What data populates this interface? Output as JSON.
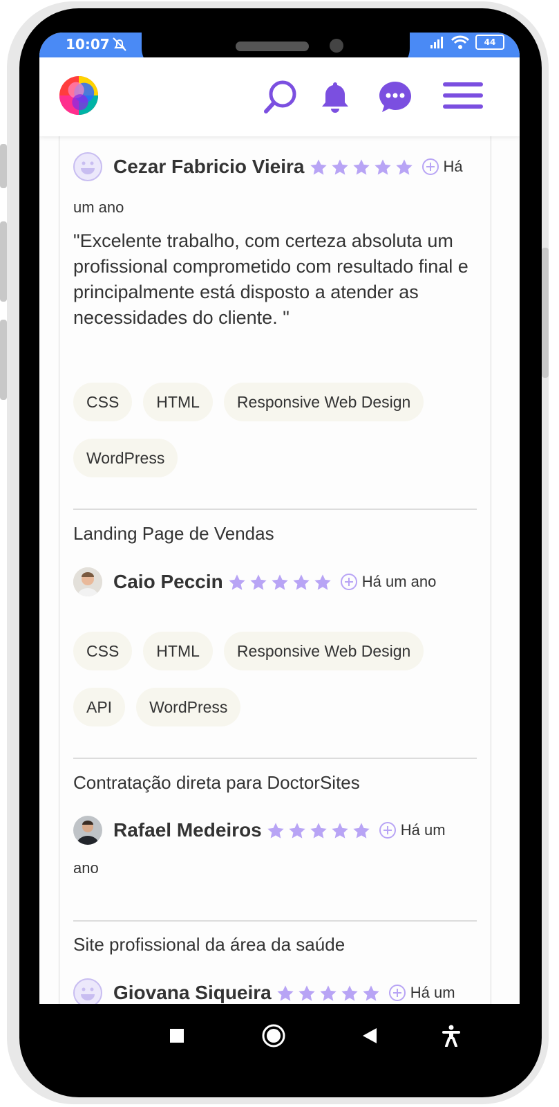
{
  "status_bar": {
    "time": "10:07",
    "battery": "44"
  },
  "header": {
    "logo_icon": "app-logo",
    "icons": [
      "search-icon",
      "bell-icon",
      "chat-icon",
      "menu-icon"
    ],
    "accent": "#7b4fe0"
  },
  "reviews": [
    {
      "project_title": "",
      "reviewer": "Cezar Fabricio Vieira",
      "rating": 5,
      "time_ago": "Há um ano",
      "time_ago_part1": "Há",
      "time_ago_part2": "um ano",
      "comment": "\"Excelente trabalho, com certeza absoluta um profissional comprometido com resultado final e principalmente está disposto a atender as necessidades do cliente. \"",
      "tags": [
        "CSS",
        "HTML",
        "Responsive Web Design",
        "WordPress"
      ]
    },
    {
      "project_title": "Landing Page de Vendas",
      "reviewer": "Caio Peccin",
      "rating": 5,
      "time_ago": "Há um ano",
      "tags": [
        "CSS",
        "HTML",
        "Responsive Web Design",
        "API",
        "WordPress"
      ]
    },
    {
      "project_title": "Contratação direta para DoctorSites",
      "reviewer": "Rafael Medeiros",
      "rating": 5,
      "time_ago": "Há um ano",
      "time_ago_part1": "Há um",
      "time_ago_part2": "ano"
    },
    {
      "project_title": "Site profissional da área da saúde",
      "reviewer": "Giovana Siqueira",
      "rating": 5,
      "time_ago_part1": "Há um"
    }
  ],
  "colors": {
    "star": "#b8a4f5",
    "tag_bg": "#f7f6ee",
    "divider": "#dcdcdc"
  }
}
